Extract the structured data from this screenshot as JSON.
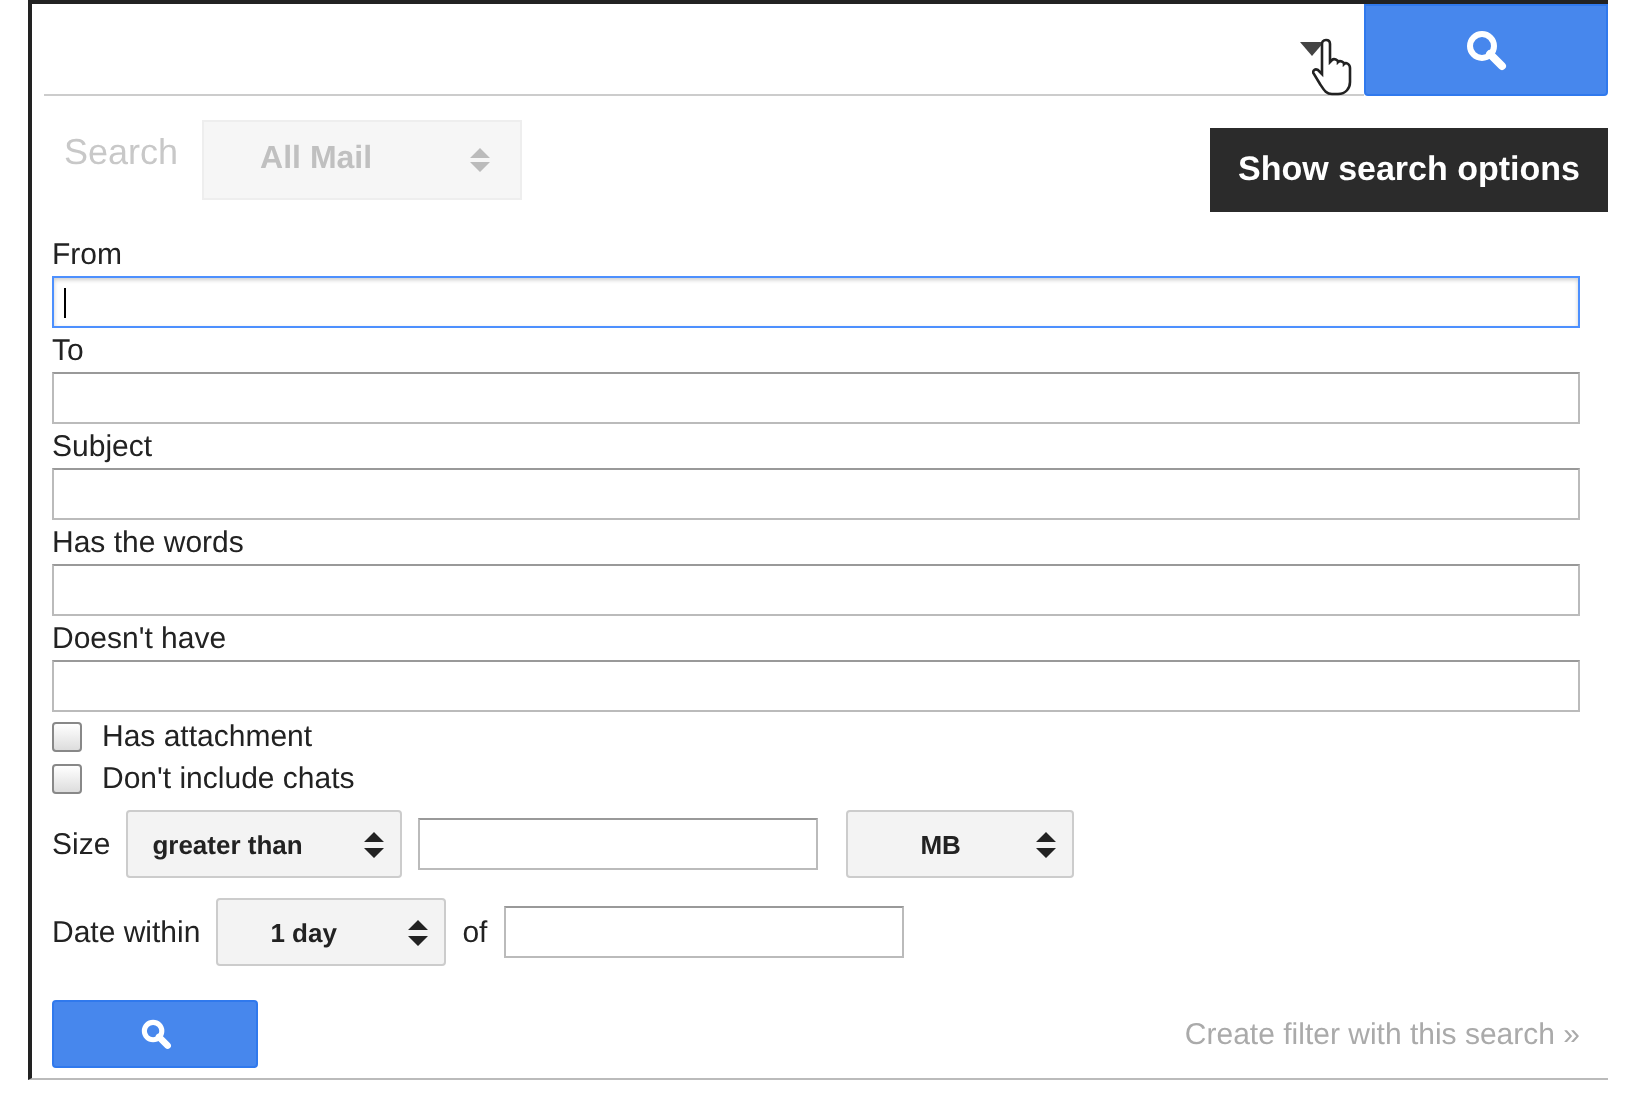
{
  "search_bar": {
    "tooltip": "Show search options"
  },
  "background_bar": {
    "label": "Search",
    "scope": "All Mail"
  },
  "fields": [
    {
      "label": "From",
      "focused": true
    },
    {
      "label": "To",
      "focused": false
    },
    {
      "label": "Subject",
      "focused": false
    },
    {
      "label": "Has the words",
      "focused": false
    },
    {
      "label": "Doesn't have",
      "focused": false
    }
  ],
  "checkboxes": [
    {
      "label": "Has attachment",
      "checked": false
    },
    {
      "label": "Don't include chats",
      "checked": false
    }
  ],
  "size": {
    "label": "Size",
    "operator": "greater than",
    "unit": "MB"
  },
  "date": {
    "label": "Date within",
    "range": "1 day",
    "of_label": "of"
  },
  "filter_link": "Create filter with this search »"
}
